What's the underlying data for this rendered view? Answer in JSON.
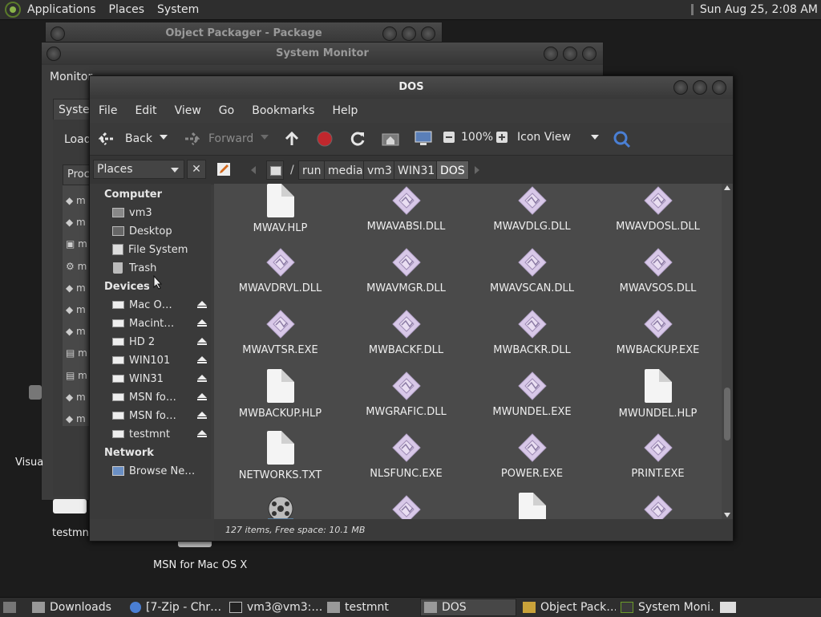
{
  "top_panel": {
    "menus": [
      "Applications",
      "Places",
      "System"
    ],
    "clock": "Sun Aug 25,  2:08 AM"
  },
  "desktop": {
    "icons": [
      {
        "label": "Visua"
      },
      {
        "label": "testmnt"
      },
      {
        "label": "MSN for Mac OS X"
      }
    ]
  },
  "background_windows": {
    "object_packager": {
      "title": "Object Packager - Package"
    },
    "system_monitor": {
      "title": "System Monitor",
      "menu_first": "Monitor",
      "tab": "Syster",
      "load_label": "Load",
      "proc_label": "Proc",
      "rows": [
        "m",
        "m",
        "m",
        "m",
        "m",
        "m",
        "m",
        "m",
        "m",
        "m",
        "m"
      ]
    }
  },
  "window": {
    "title": "DOS",
    "menu": [
      "File",
      "Edit",
      "View",
      "Go",
      "Bookmarks",
      "Help"
    ],
    "toolbar": {
      "back": "Back",
      "forward": "Forward",
      "zoom": "100%",
      "view_mode": "Icon View"
    },
    "places_combo": "Places",
    "breadcrumb": [
      "/",
      "run",
      "media",
      "vm3",
      "WIN31",
      "DOS"
    ],
    "sidebar": {
      "computer_heading": "Computer",
      "computer_items": [
        "vm3",
        "Desktop",
        "File System",
        "Trash"
      ],
      "devices_heading": "Devices",
      "devices": [
        "Mac OS X",
        "Macintosh HD",
        "HD 2",
        "WIN101",
        "WIN31",
        "MSN for Mac",
        "MSN for Mac OS X",
        "testmnt"
      ],
      "network_heading": "Network",
      "network_items": [
        "Browse Network"
      ]
    },
    "files": [
      {
        "name": "MWAV.HLP",
        "type": "doc"
      },
      {
        "name": "MWAVABSI.DLL",
        "type": "dll"
      },
      {
        "name": "MWAVDLG.DLL",
        "type": "dll"
      },
      {
        "name": "MWAVDOSL.DLL",
        "type": "dll"
      },
      {
        "name": "MWAVDRVL.DLL",
        "type": "dll"
      },
      {
        "name": "MWAVMGR.DLL",
        "type": "dll"
      },
      {
        "name": "MWAVSCAN.DLL",
        "type": "dll"
      },
      {
        "name": "MWAVSOS.DLL",
        "type": "dll"
      },
      {
        "name": "MWAVTSR.EXE",
        "type": "dll"
      },
      {
        "name": "MWBACKF.DLL",
        "type": "dll"
      },
      {
        "name": "MWBACKR.DLL",
        "type": "dll"
      },
      {
        "name": "MWBACKUP.EXE",
        "type": "dll"
      },
      {
        "name": "MWBACKUP.HLP",
        "type": "doc"
      },
      {
        "name": "MWGRAFIC.DLL",
        "type": "dll"
      },
      {
        "name": "MWUNDEL.EXE",
        "type": "dll"
      },
      {
        "name": "MWUNDEL.HLP",
        "type": "doc"
      },
      {
        "name": "NETWORKS.TXT",
        "type": "doc"
      },
      {
        "name": "NLSFUNC.EXE",
        "type": "dll"
      },
      {
        "name": "POWER.EXE",
        "type": "dll"
      },
      {
        "name": "PRINT.EXE",
        "type": "dll"
      },
      {
        "name": "",
        "type": "film"
      },
      {
        "name": "",
        "type": "dll"
      },
      {
        "name": "",
        "type": "doc"
      },
      {
        "name": "",
        "type": "dll"
      }
    ],
    "status": "127 items, Free space: 10.1 MB"
  },
  "taskbar": {
    "items": [
      "Downloads",
      "[7-Zip - Chr…",
      "vm3@vm3:…",
      "testmnt",
      "DOS",
      "Object Pack…",
      "System Moni…"
    ]
  },
  "colors": {
    "dll_icon": "#d8c8e8",
    "record_red": "#c0272d",
    "search_blue": "#4a7fd4"
  }
}
